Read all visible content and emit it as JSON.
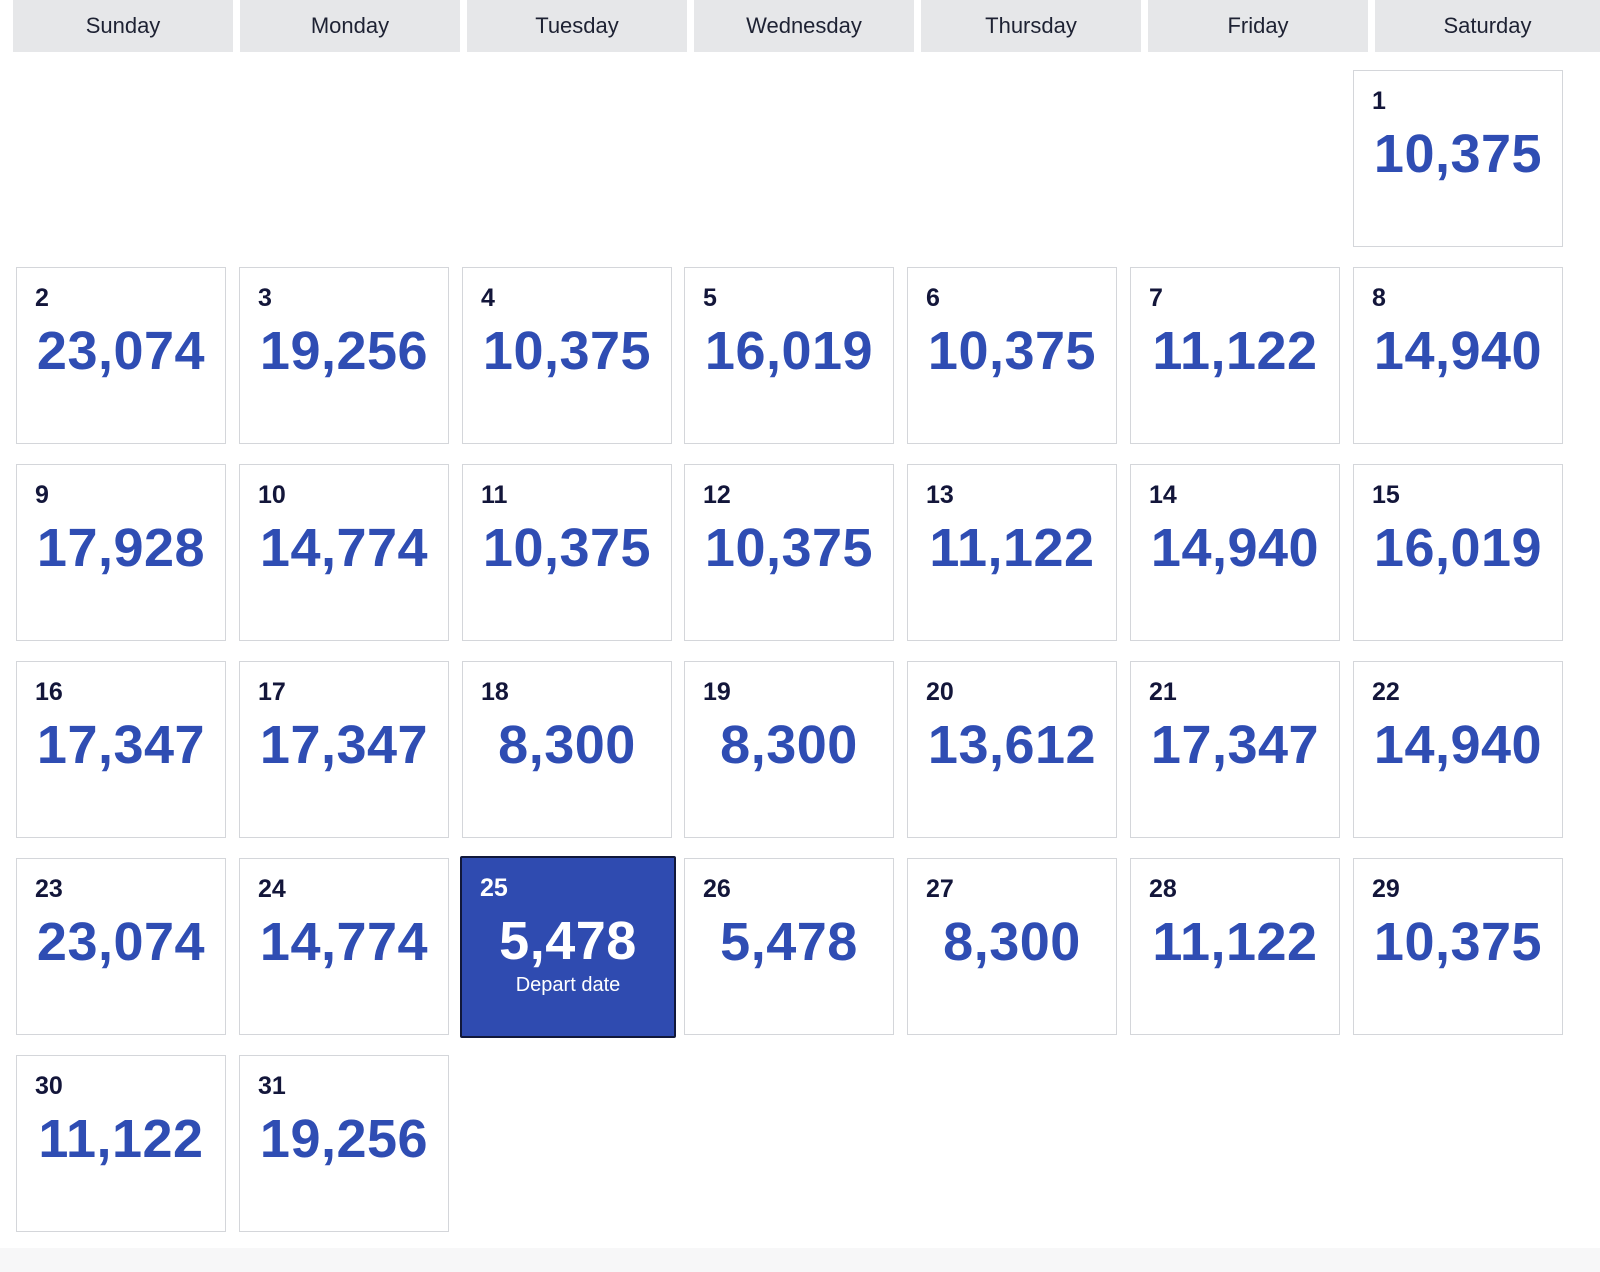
{
  "weekdays": [
    "Sunday",
    "Monday",
    "Tuesday",
    "Wednesday",
    "Thursday",
    "Friday",
    "Saturday"
  ],
  "first_weekday_index": 6,
  "days": [
    {
      "day": "1",
      "price": "10,375"
    },
    {
      "day": "2",
      "price": "23,074"
    },
    {
      "day": "3",
      "price": "19,256"
    },
    {
      "day": "4",
      "price": "10,375"
    },
    {
      "day": "5",
      "price": "16,019"
    },
    {
      "day": "6",
      "price": "10,375"
    },
    {
      "day": "7",
      "price": "11,122"
    },
    {
      "day": "8",
      "price": "14,940"
    },
    {
      "day": "9",
      "price": "17,928"
    },
    {
      "day": "10",
      "price": "14,774"
    },
    {
      "day": "11",
      "price": "10,375"
    },
    {
      "day": "12",
      "price": "10,375"
    },
    {
      "day": "13",
      "price": "11,122"
    },
    {
      "day": "14",
      "price": "14,940"
    },
    {
      "day": "15",
      "price": "16,019"
    },
    {
      "day": "16",
      "price": "17,347"
    },
    {
      "day": "17",
      "price": "17,347"
    },
    {
      "day": "18",
      "price": "8,300"
    },
    {
      "day": "19",
      "price": "8,300"
    },
    {
      "day": "20",
      "price": "13,612"
    },
    {
      "day": "21",
      "price": "17,347"
    },
    {
      "day": "22",
      "price": "14,940"
    },
    {
      "day": "23",
      "price": "23,074"
    },
    {
      "day": "24",
      "price": "14,774"
    },
    {
      "day": "25",
      "price": "5,478",
      "selected": true,
      "tag": "Depart date"
    },
    {
      "day": "26",
      "price": "5,478"
    },
    {
      "day": "27",
      "price": "8,300"
    },
    {
      "day": "28",
      "price": "11,122"
    },
    {
      "day": "29",
      "price": "10,375"
    },
    {
      "day": "30",
      "price": "11,122"
    },
    {
      "day": "31",
      "price": "19,256"
    }
  ],
  "colors": {
    "price": "#2f4db3",
    "selected_bg": "#2f4bb0",
    "header_bg": "#e6e7e9",
    "day_number": "#13163a"
  }
}
